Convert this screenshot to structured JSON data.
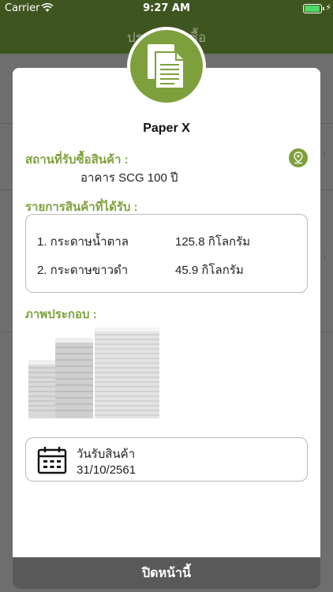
{
  "status_bar": {
    "carrier": "Carrier",
    "time": "9:27 AM",
    "battery_level": 1.0
  },
  "nav": {
    "title": "ประวัติการซื้อ"
  },
  "modal": {
    "shop_name": "Paper X",
    "location_label": "สถานที่รับซื้อสินค้า :",
    "location_value": "อาคาร SCG 100 ปี",
    "items_label": "รายการสินค้าที่ได้รับ :",
    "items": [
      {
        "name": "1. กระดาษน้ำตาล",
        "qty": "125.8  กิโลกรัม"
      },
      {
        "name": "2. กระดาษขาวดำ",
        "qty": "45.9  กิโลกรัม"
      }
    ],
    "photo_label": "ภาพประกอบ :",
    "date_label": "วันรับสินค้า",
    "date_value": "31/10/2561",
    "close_label": "ปิดหน้านี้"
  },
  "icons": {
    "badge": "document-icon",
    "location": "map-pin-icon",
    "date": "calendar-icon"
  },
  "colors": {
    "accent": "#7ea03c",
    "nav_bg": "#3f5520",
    "close_bar": "#595959"
  }
}
